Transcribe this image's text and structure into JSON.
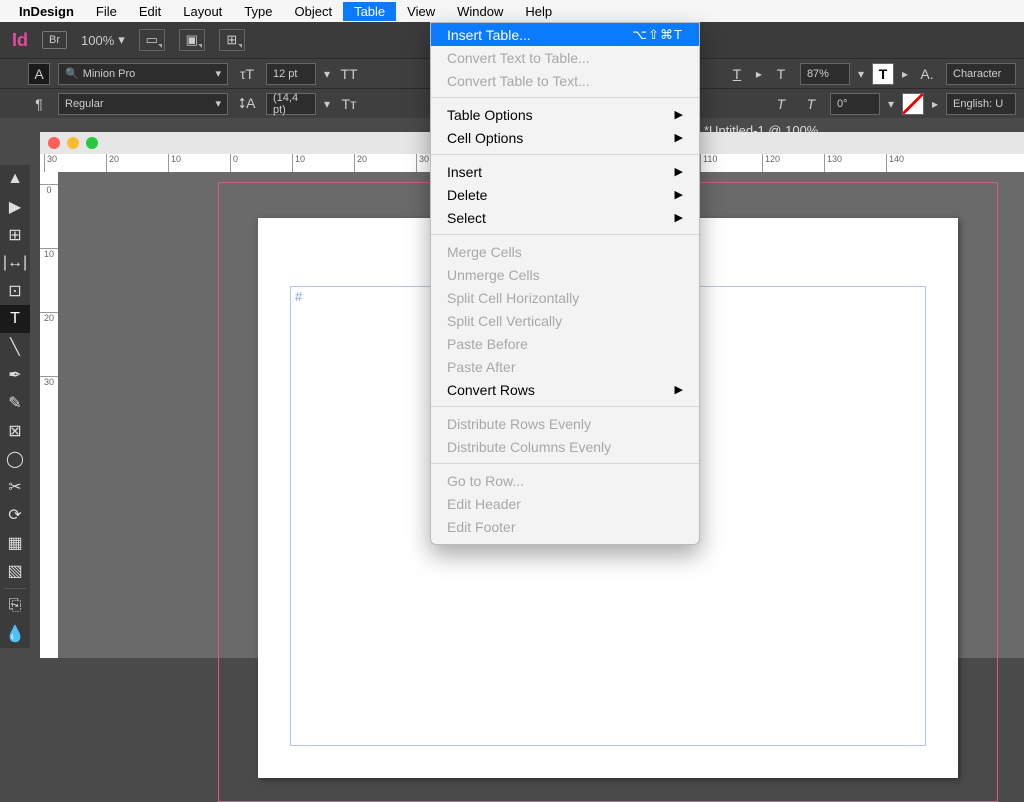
{
  "menubar": {
    "app": "InDesign",
    "items": [
      "File",
      "Edit",
      "Layout",
      "Type",
      "Object",
      "Table",
      "View",
      "Window",
      "Help"
    ],
    "selected": "Table"
  },
  "toolbar": {
    "zoom": "100%"
  },
  "controls": {
    "font": "Minion Pro",
    "style": "Regular",
    "size": "12 pt",
    "leading": "(14,4 pt)",
    "tt_label": "TT",
    "tt_small": "Tт",
    "scale": "87%",
    "rotation": "0°",
    "a_label": "A.",
    "panel1": "Character",
    "panel2": "English: U"
  },
  "doc": {
    "title": "*Untitled-1 @ 100%",
    "hruler": [
      "30",
      "20",
      "10",
      "0",
      "10",
      "20",
      "30",
      "110",
      "120",
      "130",
      "140"
    ],
    "vruler": [
      "0",
      "10",
      "20",
      "30"
    ],
    "hash": "#"
  },
  "menu": {
    "groups": [
      [
        {
          "label": "Insert Table...",
          "hl": true,
          "shortcut": "⌥⇧⌘T"
        },
        {
          "label": "Convert Text to Table...",
          "dis": true
        },
        {
          "label": "Convert Table to Text...",
          "dis": true
        }
      ],
      [
        {
          "label": "Table Options",
          "sub": true
        },
        {
          "label": "Cell Options",
          "sub": true
        }
      ],
      [
        {
          "label": "Insert",
          "sub": true
        },
        {
          "label": "Delete",
          "sub": true
        },
        {
          "label": "Select",
          "sub": true
        }
      ],
      [
        {
          "label": "Merge Cells",
          "dis": true
        },
        {
          "label": "Unmerge Cells",
          "dis": true
        },
        {
          "label": "Split Cell Horizontally",
          "dis": true
        },
        {
          "label": "Split Cell Vertically",
          "dis": true
        },
        {
          "label": "Paste Before",
          "dis": true
        },
        {
          "label": "Paste After",
          "dis": true
        },
        {
          "label": "Convert Rows",
          "sub": true
        }
      ],
      [
        {
          "label": "Distribute Rows Evenly",
          "dis": true
        },
        {
          "label": "Distribute Columns Evenly",
          "dis": true
        }
      ],
      [
        {
          "label": "Go to Row...",
          "dis": true
        },
        {
          "label": "Edit Header",
          "dis": true
        },
        {
          "label": "Edit Footer",
          "dis": true
        }
      ]
    ]
  }
}
